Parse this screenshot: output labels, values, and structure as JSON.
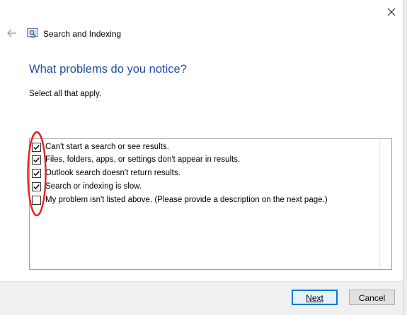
{
  "window": {
    "title": "Search and Indexing",
    "close_icon": "close-icon",
    "back_icon": "back-arrow-icon",
    "app_icon": "search-indexing-icon"
  },
  "content": {
    "heading": "What problems do you notice?",
    "instruction": "Select all that apply.",
    "options": [
      {
        "label": "Can't start a search or see results.",
        "checked": true
      },
      {
        "label": "Files, folders, apps, or settings don't appear in results.",
        "checked": true
      },
      {
        "label": "Outlook search doesn't return results.",
        "checked": true
      },
      {
        "label": "Search or indexing is slow.",
        "checked": true
      },
      {
        "label": "My problem isn't listed above. (Please provide a description on the next page.)",
        "checked": false
      }
    ]
  },
  "annotation": {
    "color": "#e8201a"
  },
  "footer": {
    "next_label": "Next",
    "cancel_label": "Cancel"
  },
  "colors": {
    "heading": "#1f4fa6",
    "footer_bg": "#f0f0f0",
    "default_button_border": "#0078d7"
  }
}
